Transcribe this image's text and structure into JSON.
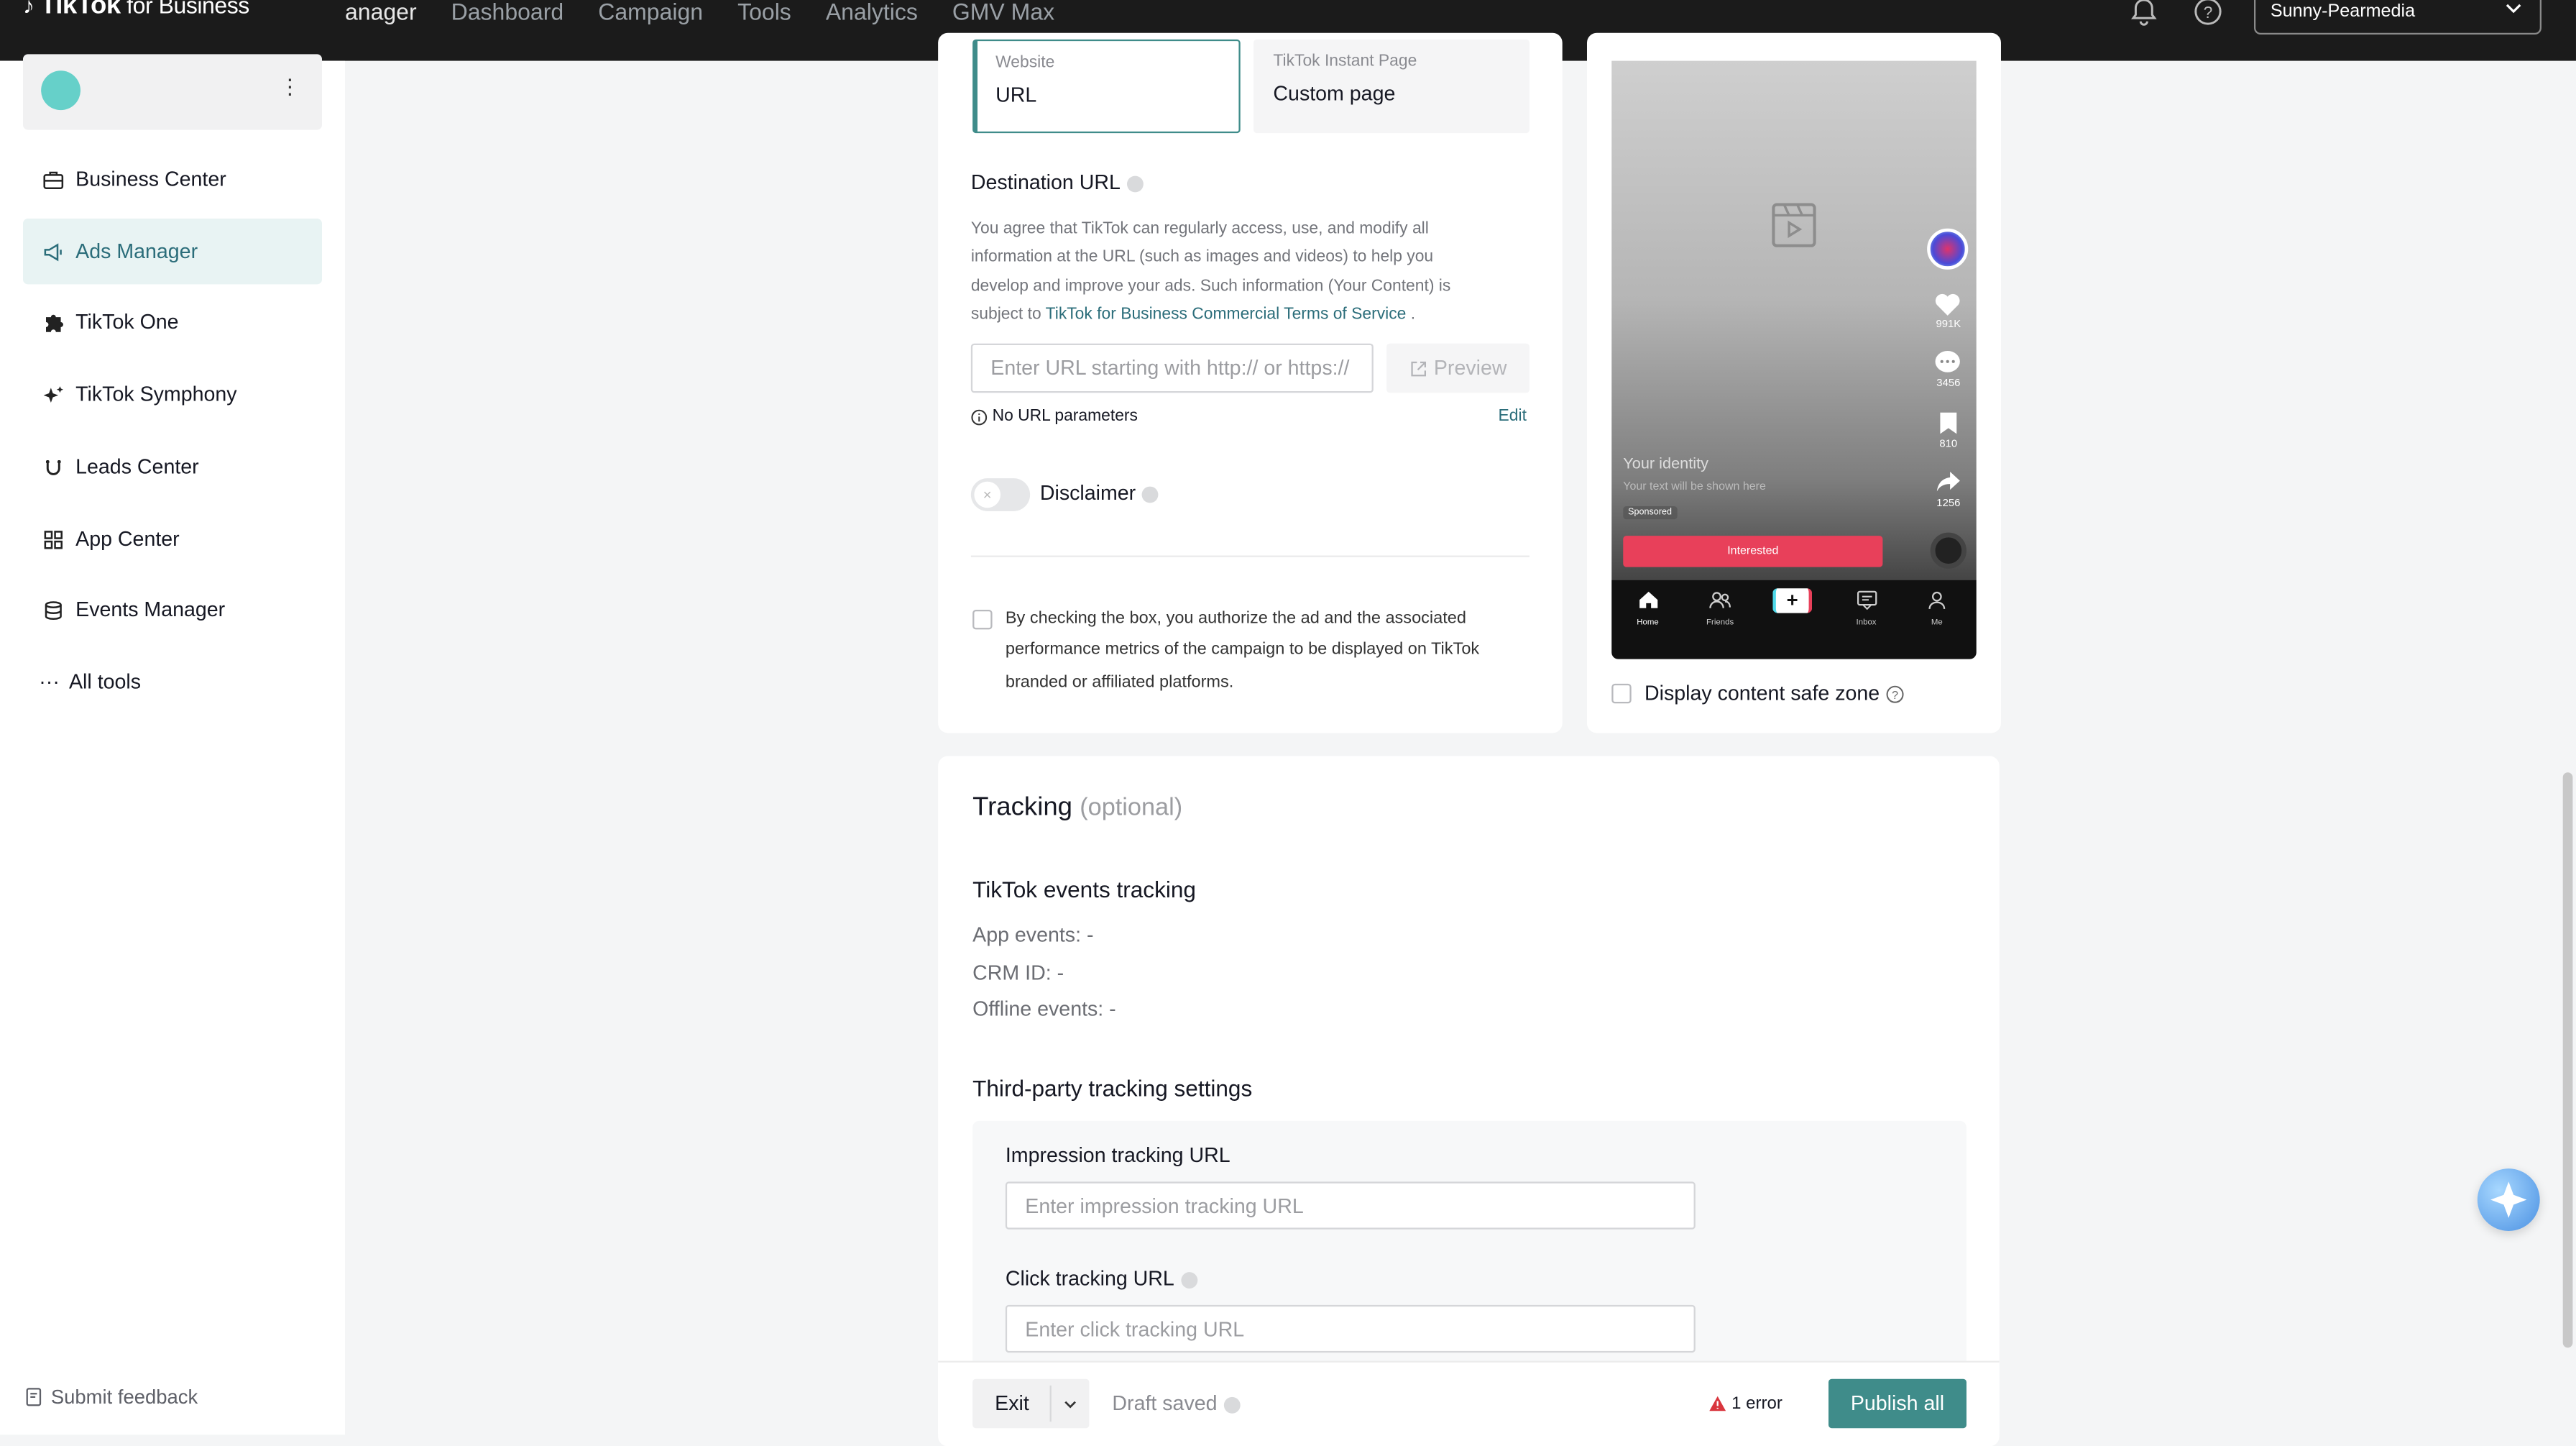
{
  "topbar": {
    "brand": "TikTok",
    "brand_sub": " for Business",
    "nav": [
      "anager",
      "Dashboard",
      "Campaign",
      "Tools",
      "Analytics",
      "GMV Max"
    ],
    "account": "Sunny-Pearmedia"
  },
  "sidebar": {
    "items": [
      {
        "label": "Business Center",
        "icon": "briefcase-icon"
      },
      {
        "label": "Ads Manager",
        "icon": "megaphone-icon"
      },
      {
        "label": "TikTok One",
        "icon": "puzzle-icon"
      },
      {
        "label": "TikTok Symphony",
        "icon": "sparkle-icon"
      },
      {
        "label": "Leads Center",
        "icon": "magnet-icon"
      },
      {
        "label": "App Center",
        "icon": "grid-icon"
      },
      {
        "label": "Events Manager",
        "icon": "database-icon"
      },
      {
        "label": "All tools",
        "icon": "more-icon"
      }
    ],
    "feedback": "Submit feedback"
  },
  "destination": {
    "tab_website_small": "Website",
    "tab_website": "URL",
    "tab_instant_small": "TikTok Instant Page",
    "tab_instant": "Custom page",
    "title": "Destination URL",
    "agree_text_1": "You agree that TikTok can regularly access, use, and modify all",
    "agree_text_2": "information at the URL (such as images and videos) to help you",
    "agree_text_3": "develop and improve your ads. Such information (Your Content) is",
    "agree_text_4": "subject to ",
    "terms_link": "TikTok for Business Commercial Terms of Service",
    "agree_text_end": " .",
    "url_placeholder": "Enter URL starting with http:// or https://",
    "preview": "Preview",
    "no_params": "No URL parameters",
    "edit": "Edit",
    "disclaimer": "Disclaimer",
    "consent_1": "By checking the box, you authorize the ad and the associated",
    "consent_2": "performance metrics of the campaign to be displayed on TikTok",
    "consent_3": "branded or affiliated platforms."
  },
  "preview": {
    "likes": "991K",
    "comments": "3456",
    "saves": "810",
    "shares": "1256",
    "identity": "Your identity",
    "text_hint": "Your text will be shown here",
    "sponsored": "Sponsored",
    "cta": "Interested",
    "tabs": [
      "Home",
      "Friends",
      "+",
      "Inbox",
      "Me"
    ],
    "safe_zone": "Display content safe zone",
    "cta_color": "#e8405a"
  },
  "tracking": {
    "title": "Tracking",
    "optional": "(optional)",
    "events_title": "TikTok events tracking",
    "app_events": "App events: -",
    "crm_id": "CRM ID: -",
    "offline_events": "Offline events: -",
    "third_party_title": "Third-party tracking settings",
    "impression_label": "Impression tracking URL",
    "impression_placeholder": "Enter impression tracking URL",
    "click_label": "Click tracking URL",
    "click_placeholder": "Enter click tracking URL"
  },
  "footer": {
    "exit": "Exit",
    "draft": "Draft saved",
    "error": "1 error",
    "publish": "Publish all",
    "accent": "#3f8c8a",
    "error_color": "#d9363e"
  }
}
